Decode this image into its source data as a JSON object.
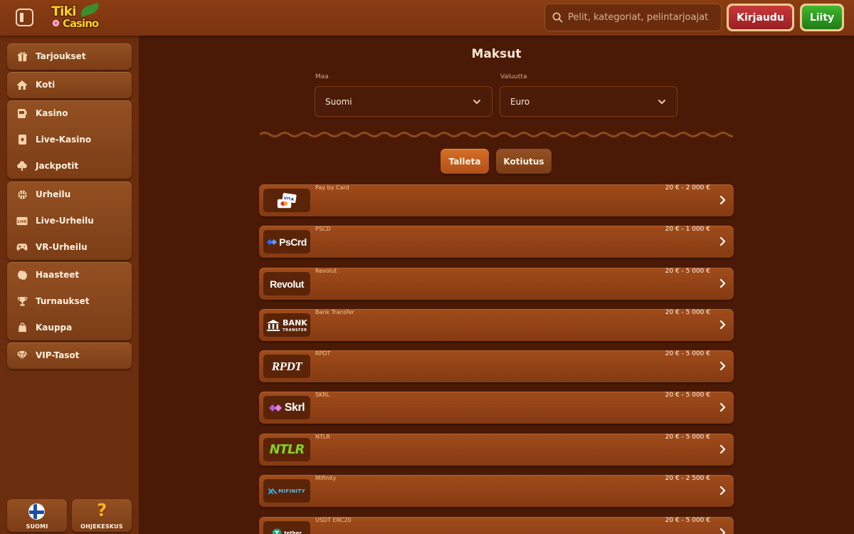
{
  "header": {
    "logo": {
      "line1": "Tiki",
      "line2": "Casino"
    },
    "search": {
      "placeholder": "Pelit, kategoriat, pelintarjoajat"
    },
    "login_label": "Kirjaudu",
    "join_label": "Liity"
  },
  "sidebar": {
    "groups": [
      [
        {
          "label": "Tarjoukset",
          "icon": "gift-icon"
        }
      ],
      [
        {
          "label": "Koti",
          "icon": "home-icon"
        }
      ],
      [
        {
          "label": "Kasino",
          "icon": "slot-machine-icon"
        },
        {
          "label": "Live-Kasino",
          "icon": "cards-icon"
        },
        {
          "label": "Jackpotit",
          "icon": "clover-icon"
        }
      ],
      [
        {
          "label": "Urheilu",
          "icon": "basketball-icon"
        },
        {
          "label": "Live-Urheilu",
          "icon": "live-icon"
        },
        {
          "label": "VR-Urheilu",
          "icon": "gamepad-icon"
        }
      ],
      [
        {
          "label": "Haasteet",
          "icon": "badge-icon"
        },
        {
          "label": "Turnaukset",
          "icon": "trophy-icon"
        },
        {
          "label": "Kauppa",
          "icon": "bag-icon"
        }
      ],
      [
        {
          "label": "VIP-Tasot",
          "icon": "diamond-icon"
        }
      ]
    ],
    "bottom": {
      "language_label": "SUOMI",
      "help_label": "OHJEKESKUS"
    }
  },
  "main": {
    "title": "Maksut",
    "country": {
      "label": "Maa",
      "value": "Suomi"
    },
    "currency": {
      "label": "Valuutta",
      "value": "Euro"
    },
    "tabs": [
      {
        "label": "Talleta",
        "active": true
      },
      {
        "label": "Kotiutus",
        "active": false
      }
    ],
    "payment_methods": [
      {
        "name": "Pay by Card",
        "limit": "20 € - 2 000 €",
        "logo_text": "VISA"
      },
      {
        "name": "PSCD",
        "limit": "20 € - 1 000 €",
        "logo_text": "PsCrd"
      },
      {
        "name": "Revolut",
        "limit": "20 € - 5 000 €",
        "logo_text": "Revolut"
      },
      {
        "name": "Bank Transfer",
        "limit": "20 € - 5 000 €",
        "logo_text": "BANK",
        "logo_sub": "TRANSFER"
      },
      {
        "name": "RPDT",
        "limit": "20 € - 5 000 €",
        "logo_text": "RPDT"
      },
      {
        "name": "SKRL",
        "limit": "20 € - 5 000 €",
        "logo_text": "Skrl"
      },
      {
        "name": "NTLR",
        "limit": "20 € - 5 000 €",
        "logo_text": "NTLR"
      },
      {
        "name": "Mifinity",
        "limit": "20 € - 2 500 €",
        "logo_text": "MIFINITY"
      },
      {
        "name": "USDT ERC20",
        "limit": "20 € - 5 000 €",
        "logo_text": "tether"
      }
    ]
  },
  "colors": {
    "background": "#4a1a06",
    "accent": "#d66f24",
    "login": "#c8383a",
    "join": "#3fb82c"
  }
}
